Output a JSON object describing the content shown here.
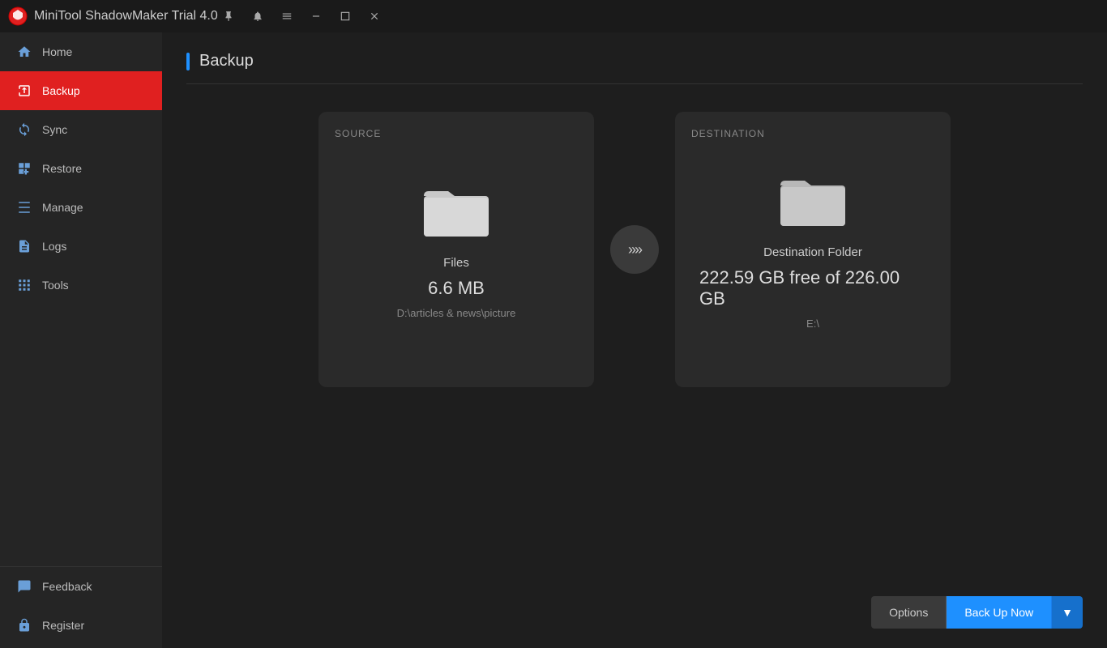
{
  "titlebar": {
    "logo_alt": "MiniTool Logo",
    "title": "MiniTool ShadowMaker Trial 4.0",
    "controls": {
      "pin": "📌",
      "info": "🔔",
      "menu": "☰",
      "minimize": "—",
      "maximize": "☐",
      "close": "✕"
    }
  },
  "sidebar": {
    "items": [
      {
        "id": "home",
        "label": "Home",
        "active": false
      },
      {
        "id": "backup",
        "label": "Backup",
        "active": true
      },
      {
        "id": "sync",
        "label": "Sync",
        "active": false
      },
      {
        "id": "restore",
        "label": "Restore",
        "active": false
      },
      {
        "id": "manage",
        "label": "Manage",
        "active": false
      },
      {
        "id": "logs",
        "label": "Logs",
        "active": false
      },
      {
        "id": "tools",
        "label": "Tools",
        "active": false
      }
    ],
    "bottom_items": [
      {
        "id": "feedback",
        "label": "Feedback"
      },
      {
        "id": "register",
        "label": "Register"
      }
    ]
  },
  "page": {
    "title": "Backup"
  },
  "source": {
    "label": "SOURCE",
    "type": "Files",
    "size": "6.6 MB",
    "path": "D:\\articles & news\\picture"
  },
  "destination": {
    "label": "DESTINATION",
    "type": "Destination Folder",
    "free": "222.59 GB free of 226.00 GB",
    "path": "E:\\"
  },
  "arrow": ">>>",
  "buttons": {
    "options": "Options",
    "backup_now": "Back Up Now",
    "dropdown": "▼"
  }
}
